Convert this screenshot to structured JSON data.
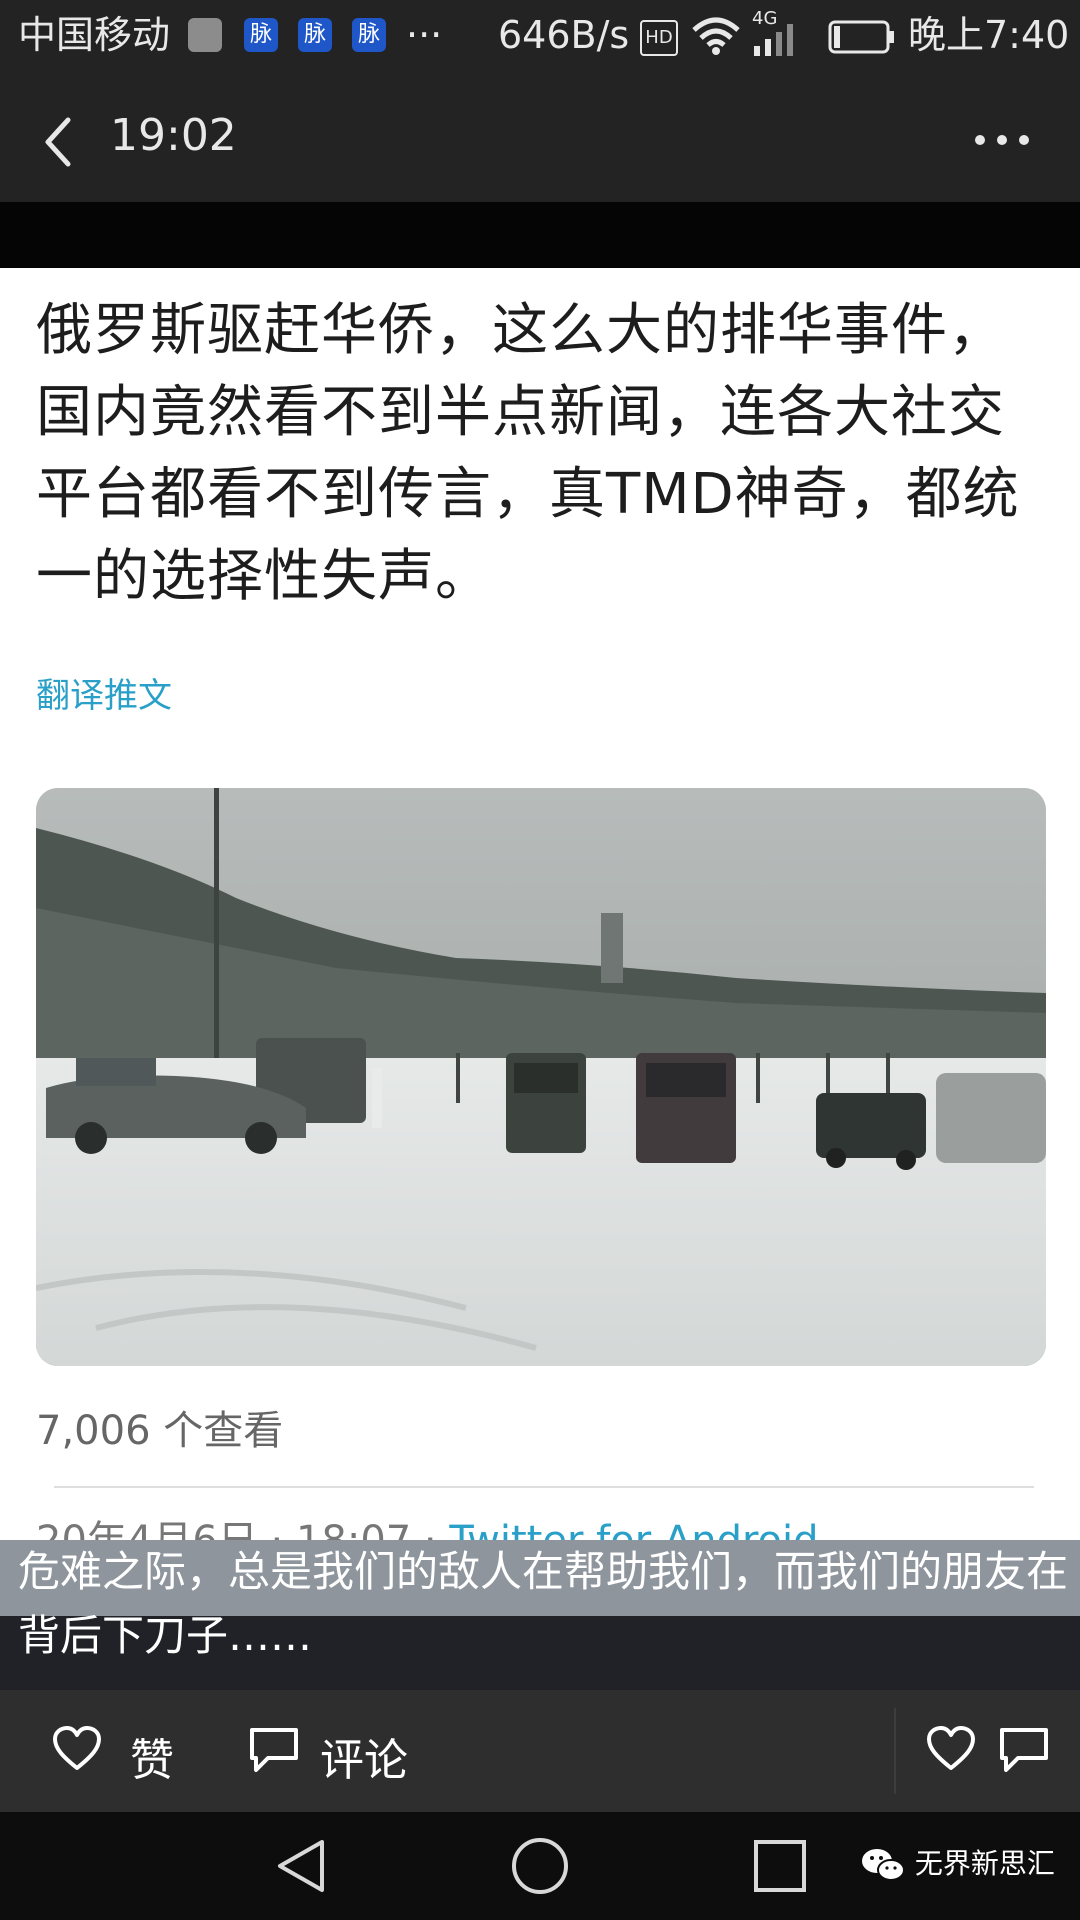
{
  "status_bar": {
    "carrier": "中国移动",
    "app_icon_label": "脉",
    "overflow": "···",
    "net_speed": "646B/s",
    "hd_badge": "HD",
    "network_type": "4G",
    "clock": "晚上7:40"
  },
  "header": {
    "title": "19:02"
  },
  "post": {
    "text": "俄罗斯驱赶华侨，这么大的排华事件，国内竟然看不到半点新闻，连各大社交平台都看不到传言，真TMD神奇，都统一的选择性失声。",
    "translate_link": "翻译推文",
    "views": "7,006 个查看",
    "date": "20年4月6日 · 18:07 · ",
    "source": "Twitter for Android"
  },
  "caption": {
    "text": "危难之际，总是我们的敌人在帮助我们，而我们的朋友在背后下刀子……"
  },
  "actions": {
    "like_label": "赞",
    "comment_label": "评论"
  },
  "watermark": {
    "text": "无界新思汇"
  }
}
